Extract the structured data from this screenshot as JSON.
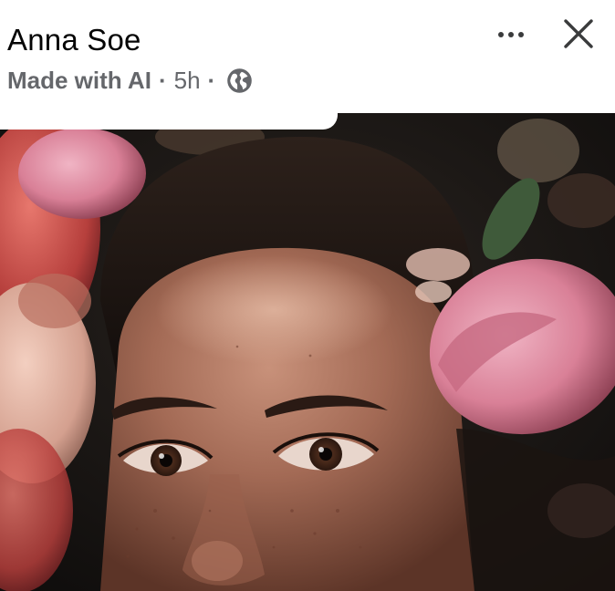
{
  "post": {
    "author_name": "Anna Soe",
    "ai_label": "Made with AI",
    "separator": "·",
    "time_ago": "5h",
    "audience_icon": "globe-icon"
  },
  "controls": {
    "more_icon": "more-horizontal-icon",
    "close_icon": "close-icon"
  },
  "colors": {
    "name_text": "#050505",
    "meta_text": "#65676b",
    "icon_dark": "#3a3b3c",
    "background": "#ffffff"
  }
}
